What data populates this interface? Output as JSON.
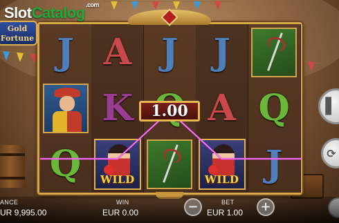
{
  "watermark": {
    "part1": "Slot",
    "part2": "Catalog",
    "suffix": ".com"
  },
  "game_logo": {
    "line1": "Gold",
    "line2": "Fortune"
  },
  "reels": [
    [
      "J",
      "portrait",
      "Q"
    ],
    [
      "A",
      "K",
      "wild"
    ],
    [
      "J",
      "Q",
      "sword"
    ],
    [
      "J",
      "A",
      "wild"
    ],
    [
      "sword",
      "Q",
      "J"
    ]
  ],
  "symbols": {
    "wild_label": "WILD"
  },
  "win_display": {
    "amount": "1.00"
  },
  "bottom_bar": {
    "balance_label": "ANCE",
    "balance_value": "UR 9,995.00",
    "win_label": "WIN",
    "win_value": "EUR 0.00",
    "bet_label": "BET",
    "bet_value": "EUR 1.00",
    "minus_icon": "−",
    "plus_icon": "+"
  },
  "colors": {
    "frame_gold": "#d8a848",
    "payline": "#e040e0",
    "letter_J": "#4f7fb8",
    "letter_A": "#c9484a",
    "letter_K": "#9a3d92",
    "letter_Q": "#69b83a",
    "wild_text": "#f7d34a"
  }
}
